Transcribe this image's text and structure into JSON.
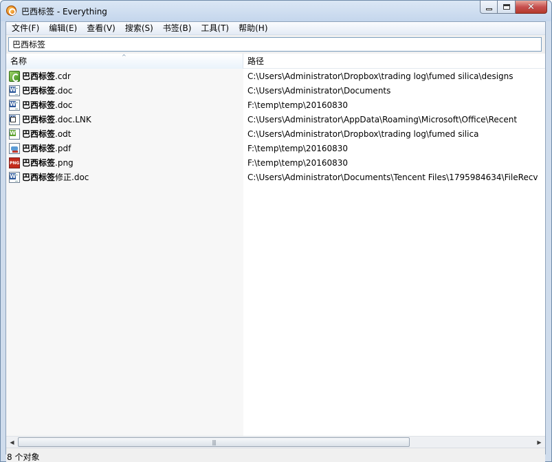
{
  "window": {
    "title": "巴西标签 - Everything",
    "app_icon": "everything-app-icon",
    "controls": {
      "minimize": "minimize-icon",
      "maximize": "maximize-icon",
      "close": "close-icon",
      "close_glyph": "✕"
    }
  },
  "menu": [
    {
      "label": "文件(F)"
    },
    {
      "label": "编辑(E)"
    },
    {
      "label": "查看(V)"
    },
    {
      "label": "搜索(S)"
    },
    {
      "label": "书签(B)"
    },
    {
      "label": "工具(T)"
    },
    {
      "label": "帮助(H)"
    }
  ],
  "search": {
    "value": "巴西标签"
  },
  "columns": {
    "name": "名称",
    "path": "路径",
    "sort_glyph": "^"
  },
  "files": [
    {
      "icon": "coreldraw-file-icon",
      "name_bold": "巴西标签",
      "name_rest": ".cdr",
      "path": "C:\\Users\\Administrator\\Dropbox\\trading log\\fumed silica\\designs"
    },
    {
      "icon": "word-document-icon",
      "name_bold": "巴西标签",
      "name_rest": ".doc",
      "path": "C:\\Users\\Administrator\\Documents"
    },
    {
      "icon": "word-document-icon",
      "name_bold": "巴西标签",
      "name_rest": ".doc",
      "path": "F:\\temp\\temp\\20160830"
    },
    {
      "icon": "word-shortcut-icon",
      "name_bold": "巴西标签",
      "name_rest": ".doc.LNK",
      "path": "C:\\Users\\Administrator\\AppData\\Roaming\\Microsoft\\Office\\Recent"
    },
    {
      "icon": "odt-document-icon",
      "name_bold": "巴西标签",
      "name_rest": ".odt",
      "path": "C:\\Users\\Administrator\\Dropbox\\trading log\\fumed silica"
    },
    {
      "icon": "pdf-file-icon",
      "name_bold": "巴西标签",
      "name_rest": ".pdf",
      "path": "F:\\temp\\temp\\20160830"
    },
    {
      "icon": "png-image-icon",
      "name_bold": "巴西标签",
      "name_rest": ".png",
      "path": "F:\\temp\\temp\\20160830"
    },
    {
      "icon": "word-document-icon",
      "name_bold": "巴西标签",
      "name_rest": "修正.doc",
      "path": "C:\\Users\\Administrator\\Documents\\Tencent Files\\1795984634\\FileRecv"
    }
  ],
  "scrollbar": {
    "left_arrow": "◀",
    "right_arrow": "▶",
    "grip": "|||"
  },
  "status": {
    "text": "8 个对象"
  }
}
